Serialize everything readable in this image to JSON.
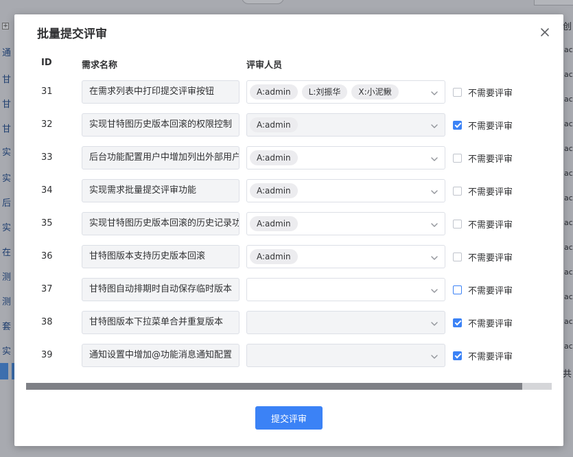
{
  "background": {
    "left_items": [
      "通",
      "甘",
      "甘",
      "甘",
      "实",
      "实",
      "后",
      "实",
      "在",
      "测",
      "测",
      "套",
      "实"
    ],
    "right_items": [
      "ac",
      "ac",
      "ac",
      "ac",
      "ac",
      "ac",
      "ac",
      "ac",
      "ac",
      "ac",
      "ac",
      "ac",
      "ac"
    ],
    "top_right_header": "创",
    "bottom_right_text": "共",
    "plus_glyph": "+"
  },
  "modal": {
    "title": "批量提交评审",
    "close_icon": "close-icon",
    "columns": {
      "id": "ID",
      "name": "需求名称",
      "reviewer": "评审人员"
    },
    "checkbox_label": "不需要评审",
    "submit_label": "提交评审",
    "rows": [
      {
        "id": "31",
        "name": "在需求列表中打印提交评审按钮",
        "reviewers": [
          "A:admin",
          "L:刘振华",
          "X:小泥鳅"
        ],
        "no_review": false,
        "disabled": false
      },
      {
        "id": "32",
        "name": "实现甘特图历史版本回滚的权限控制",
        "reviewers": [
          "A:admin"
        ],
        "no_review": true,
        "disabled": true
      },
      {
        "id": "33",
        "name": "后台功能配置用户中增加列出外部用户",
        "reviewers": [
          "A:admin"
        ],
        "no_review": false,
        "disabled": false
      },
      {
        "id": "34",
        "name": "实现需求批量提交评审功能",
        "reviewers": [
          "A:admin"
        ],
        "no_review": false,
        "disabled": false
      },
      {
        "id": "35",
        "name": "实现甘特图历史版本回滚的历史记录功能",
        "reviewers": [
          "A:admin"
        ],
        "no_review": false,
        "disabled": false
      },
      {
        "id": "36",
        "name": "甘特图版本支持历史版本回滚",
        "reviewers": [
          "A:admin"
        ],
        "no_review": false,
        "disabled": false
      },
      {
        "id": "37",
        "name": "甘特图自动排期时自动保存临时版本",
        "reviewers": [],
        "no_review": false,
        "disabled": false,
        "focused": true
      },
      {
        "id": "38",
        "name": "甘特图版本下拉菜单合并重复版本",
        "reviewers": [],
        "no_review": true,
        "disabled": true
      },
      {
        "id": "39",
        "name": "通知设置中增加@功能消息通知配置",
        "reviewers": [],
        "no_review": true,
        "disabled": true
      }
    ]
  },
  "colors": {
    "primary": "#3b82f6",
    "border": "#dcdfe6",
    "disabled_bg": "#f3f4f6",
    "tag_bg": "#ececef",
    "overlay": "#8e9097"
  }
}
